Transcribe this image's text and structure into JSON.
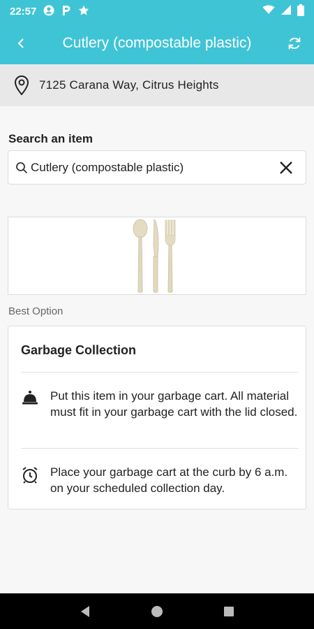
{
  "status_bar": {
    "time": "22:57"
  },
  "header": {
    "title": "Cutlery (compostable plastic)"
  },
  "location": {
    "address": "7125 Carana Way, Citrus Heights"
  },
  "search": {
    "label": "Search an item",
    "value": "Cutlery (compostable plastic)"
  },
  "result": {
    "section_label": "Best Option",
    "card_title": "Garbage Collection",
    "instructions": [
      {
        "icon": "bell-icon",
        "text": "Put this item in your garbage cart. All material must fit in your garbage cart with the lid closed."
      },
      {
        "icon": "alarm-clock-icon",
        "text": "Place your garbage cart at the curb by 6 a.m. on your scheduled collection day."
      }
    ]
  },
  "colors": {
    "accent": "#3fc4d6",
    "location_bg": "#e8e8e8",
    "page_bg": "#f7f7f7"
  }
}
